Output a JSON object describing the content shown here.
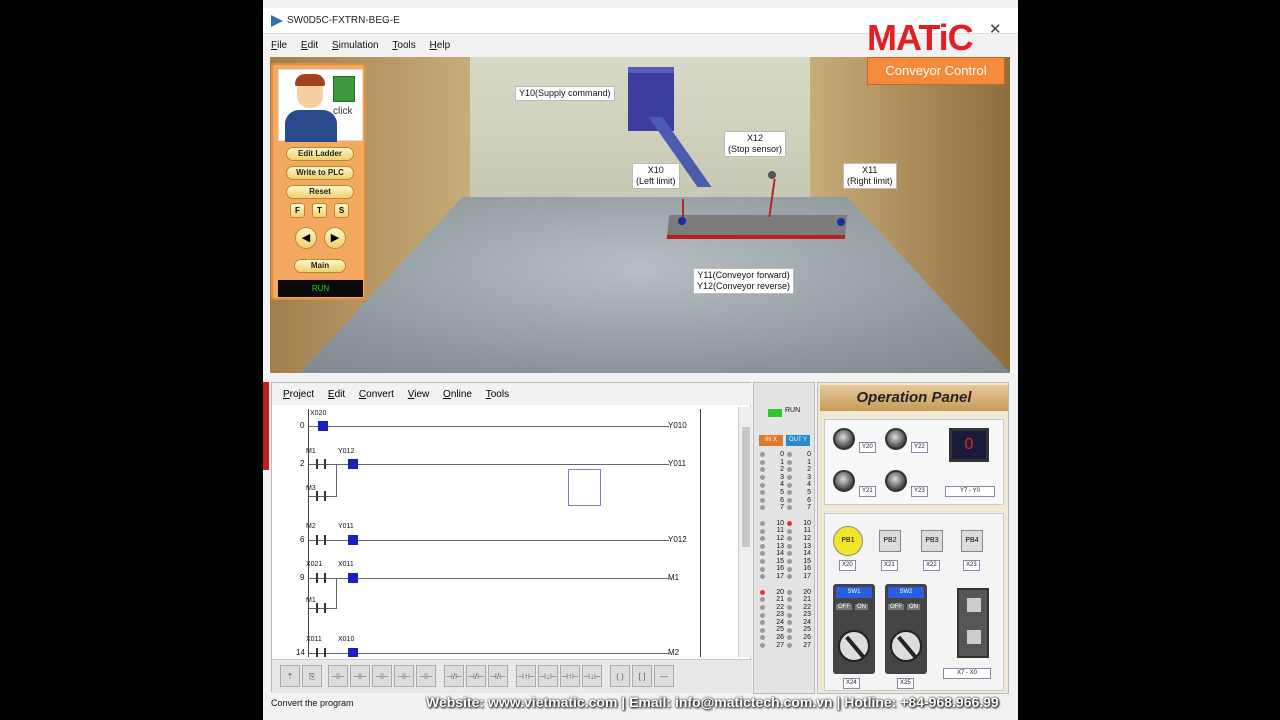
{
  "window": {
    "title": "SW0D5C-FXTRN-BEG-E",
    "close_icon": "close-icon"
  },
  "brand": {
    "logo_text": "MATiC",
    "color": "#e31e24"
  },
  "menubar": {
    "items": [
      "File",
      "Edit",
      "Simulation",
      "Tools",
      "Help"
    ]
  },
  "scene": {
    "labels": {
      "supply": "Y10(Supply command)",
      "stop_sensor": "X12\n(Stop sensor)",
      "left_limit": "X10\n(Left limit)",
      "right_limit": "X11\n(Right limit)",
      "conveyor": "Y11(Conveyor forward)\nY12(Conveyor reverse)"
    },
    "title": "Conveyor Control"
  },
  "side_panel": {
    "click_text": "click",
    "buttons": {
      "edit_ladder": "Edit Ladder",
      "write_plc": "Write to PLC",
      "reset": "Reset",
      "main": "Main"
    },
    "fts": [
      "F",
      "T",
      "S"
    ],
    "arrows": {
      "left": "◀",
      "right": "▶"
    },
    "run_status": "RUN"
  },
  "ladder": {
    "menu": [
      "Project",
      "Edit",
      "Convert",
      "View",
      "Online",
      "Tools"
    ],
    "rungs": [
      {
        "num": "0",
        "contacts": [
          {
            "label": "X020",
            "on": true
          }
        ],
        "coil": "Y010"
      },
      {
        "num": "2",
        "contacts": [
          {
            "label": "M1",
            "on": false
          },
          {
            "label": "Y012",
            "on": true
          }
        ],
        "branch": "M3",
        "coil": "Y011"
      },
      {
        "num": "6",
        "contacts": [
          {
            "label": "M2",
            "on": false
          },
          {
            "label": "Y011",
            "on": true
          }
        ],
        "coil": "Y012"
      },
      {
        "num": "9",
        "contacts": [
          {
            "label": "X021",
            "on": false
          },
          {
            "label": "X011",
            "on": true
          }
        ],
        "branch": "M1",
        "coil": "M1"
      },
      {
        "num": "14",
        "contacts": [
          {
            "label": "X011",
            "on": false
          },
          {
            "label": "X010",
            "on": true
          }
        ],
        "coil": "M2"
      }
    ],
    "status": "Convert the program"
  },
  "io": {
    "run_label": "RUN",
    "in_header": "IN X",
    "out_header": "OUT Y",
    "in_numbers": [
      "0",
      "1",
      "2",
      "3",
      "4",
      "5",
      "6",
      "7",
      "10",
      "11",
      "12",
      "13",
      "14",
      "15",
      "16",
      "17",
      "20",
      "21",
      "22",
      "23",
      "24",
      "25",
      "26",
      "27"
    ],
    "out_numbers": [
      "0",
      "1",
      "2",
      "3",
      "4",
      "5",
      "6",
      "7",
      "10",
      "11",
      "12",
      "13",
      "14",
      "15",
      "16",
      "17",
      "20",
      "21",
      "22",
      "23",
      "24",
      "25",
      "26",
      "27"
    ],
    "lit_out": [
      "10"
    ],
    "lit_in": [
      "20"
    ]
  },
  "op_panel": {
    "title": "Operation Panel",
    "lamps": [
      "Y20",
      "Y22",
      "Y21",
      "Y23"
    ],
    "display": {
      "value": "0",
      "label": "Y7 - Y0"
    },
    "push_buttons": [
      {
        "name": "PB1",
        "addr": "X20"
      },
      {
        "name": "PB2",
        "addr": "X21"
      },
      {
        "name": "PB3",
        "addr": "X22"
      },
      {
        "name": "PB4",
        "addr": "X23"
      }
    ],
    "switches": [
      {
        "name": "SW1",
        "off": "OFF",
        "on": "ON",
        "addr": "X24"
      },
      {
        "name": "SW2",
        "off": "OFF",
        "on": "ON",
        "addr": "X25"
      }
    ],
    "dip_label": "X7 - X0"
  },
  "footer": "Website: www.vietmatic.com | Email: info@matictech.com.vn | Hotline: +84-968.966.99"
}
